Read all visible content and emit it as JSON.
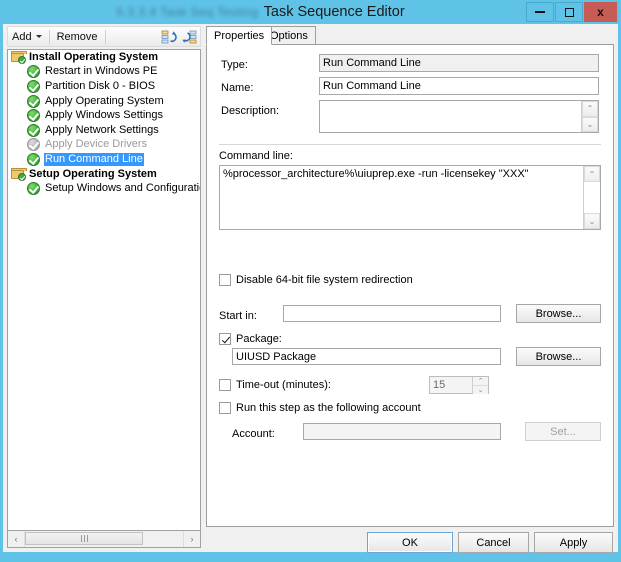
{
  "window": {
    "title_redacted": "5.3.3.4 Task Seq Testing",
    "title": "Task Sequence Editor",
    "minimize_label": "—",
    "maximize_label": "□",
    "close_label": "x"
  },
  "toolbar": {
    "add_label": "Add",
    "remove_label": "Remove",
    "move_up_icon": "move-up-icon",
    "move_down_icon": "move-down-icon"
  },
  "tree": {
    "items": [
      {
        "label": "Install Operating System",
        "type": "group",
        "icon": "folder-checked-icon",
        "state": "normal"
      },
      {
        "label": "Restart in Windows PE",
        "type": "child",
        "icon": "green-check-icon",
        "state": "normal"
      },
      {
        "label": "Partition Disk 0 - BIOS",
        "type": "child",
        "icon": "green-check-icon",
        "state": "normal"
      },
      {
        "label": "Apply Operating System",
        "type": "child",
        "icon": "green-check-icon",
        "state": "normal"
      },
      {
        "label": "Apply Windows Settings",
        "type": "child",
        "icon": "green-check-icon",
        "state": "normal"
      },
      {
        "label": "Apply Network Settings",
        "type": "child",
        "icon": "green-check-icon",
        "state": "normal"
      },
      {
        "label": "Apply Device Drivers",
        "type": "child",
        "icon": "grey-check-icon",
        "state": "disabled"
      },
      {
        "label": "Run Command Line",
        "type": "child",
        "icon": "green-check-icon",
        "state": "selected"
      },
      {
        "label": "Setup Operating System",
        "type": "group",
        "icon": "folder-checked-icon",
        "state": "normal"
      },
      {
        "label": "Setup Windows and Configuration",
        "type": "child",
        "icon": "green-check-icon",
        "state": "normal"
      }
    ],
    "scrollbar": {
      "left_arrow": "‹",
      "right_arrow": "›"
    }
  },
  "tabs": {
    "properties": "Properties",
    "options": "Options",
    "active": "Properties"
  },
  "form": {
    "type_label": "Type:",
    "type_value": "Run Command Line",
    "name_label": "Name:",
    "name_value": "Run Command Line",
    "description_label": "Description:",
    "description_value": "",
    "command_line_label": "Command line:",
    "command_line_value": "%processor_architecture%\\uiuprep.exe -run -licensekey \"XXX\"",
    "disable_redirection_label": "Disable 64-bit file system redirection",
    "disable_redirection_checked": false,
    "start_in_label": "Start in:",
    "start_in_value": "",
    "start_in_browse_label": "Browse...",
    "package_label": "Package:",
    "package_checked": true,
    "package_value": "UIUSD Package",
    "package_browse_label": "Browse...",
    "timeout_label": "Time-out (minutes):",
    "timeout_checked": false,
    "timeout_value": "15",
    "run_as_account_label": "Run this step as the following account",
    "run_as_account_checked": false,
    "account_label": "Account:",
    "account_value": "",
    "account_set_label": "Set...",
    "scroll_up_glyph": "⌃",
    "scroll_down_glyph": "⌄"
  },
  "footer": {
    "ok_label": "OK",
    "cancel_label": "Cancel",
    "apply_label": "Apply"
  },
  "colors": {
    "titlebar": "#5fc3e8",
    "close_button": "#c75b56",
    "selection": "#3399ff",
    "status_ok": "#44b13d",
    "status_disabled": "#b5b5b5"
  }
}
